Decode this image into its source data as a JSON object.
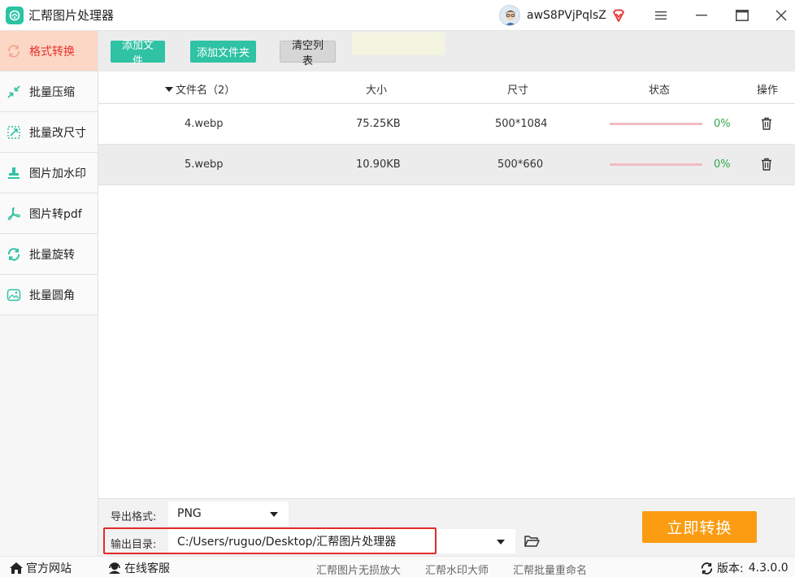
{
  "app": {
    "title": "汇帮图片处理器"
  },
  "user": {
    "name": "awS8PVjPqlsZ"
  },
  "sidebar": {
    "items": [
      {
        "label": "格式转换",
        "icon": "format-convert-icon",
        "active": true
      },
      {
        "label": "批量压缩",
        "icon": "compress-icon",
        "active": false
      },
      {
        "label": "批量改尺寸",
        "icon": "resize-icon",
        "active": false
      },
      {
        "label": "图片加水印",
        "icon": "watermark-icon",
        "active": false
      },
      {
        "label": "图片转pdf",
        "icon": "pdf-icon",
        "active": false
      },
      {
        "label": "批量旋转",
        "icon": "rotate-icon",
        "active": false
      },
      {
        "label": "批量圆角",
        "icon": "rounded-corner-icon",
        "active": false
      }
    ]
  },
  "toolbar": {
    "add_file": "添加文件",
    "add_folder": "添加文件夹",
    "clear_list": "清空列表"
  },
  "table": {
    "headers": {
      "filename": "文件名（2）",
      "size": "大小",
      "dimensions": "尺寸",
      "status": "状态",
      "action": "操作"
    },
    "rows": [
      {
        "filename": "4.webp",
        "size": "75.25KB",
        "dimensions": "500*1084",
        "progress": 0,
        "percent": "0%"
      },
      {
        "filename": "5.webp",
        "size": "10.90KB",
        "dimensions": "500*660",
        "progress": 0,
        "percent": "0%"
      }
    ]
  },
  "export": {
    "format_label": "导出格式:",
    "format_value": "PNG",
    "dir_label": "输出目录:",
    "dir_value": "C:/Users/ruguo/Desktop/汇帮图片处理器",
    "convert_button": "立即转换"
  },
  "statusbar": {
    "website": "官方网站",
    "support": "在线客服",
    "links": [
      "汇帮图片无损放大",
      "汇帮水印大师",
      "汇帮批量重命名"
    ],
    "version_label": "版本:",
    "version_value": "4.3.0.0"
  },
  "colors": {
    "accent": "#2fc2a4",
    "active_bg": "#fcd7c6",
    "active_text": "#e8312c",
    "convert": "#fb9c13",
    "progress_track": "#f1bcc7",
    "percent": "#34a84a",
    "highlight_border": "#e22b2b"
  }
}
